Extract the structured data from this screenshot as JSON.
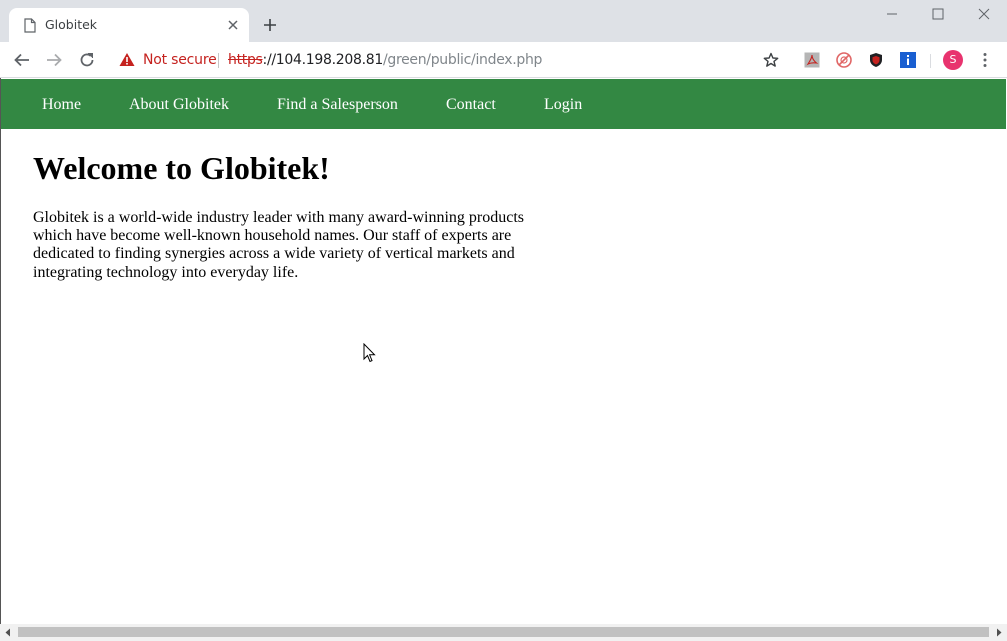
{
  "browser": {
    "tab": {
      "title": "Globitek"
    },
    "security": {
      "label": "Not secure"
    },
    "url": {
      "scheme": "https",
      "host": "://104.198.208.81",
      "path": "/green/public/index.php"
    },
    "profile": {
      "initial": "S"
    },
    "colors": {
      "warning": "#c5221f",
      "avatar": "#e8336e"
    }
  },
  "site": {
    "nav": {
      "items": [
        {
          "label": "Home"
        },
        {
          "label": "About Globitek"
        },
        {
          "label": "Find a Salesperson"
        },
        {
          "label": "Contact"
        },
        {
          "label": "Login"
        }
      ],
      "color": "#338843"
    },
    "heading": "Welcome to Globitek!",
    "intro": "Globitek is a world-wide industry leader with many award-winning products which have become well-known household names. Our staff of experts are dedicated to finding synergies across a wide variety of vertical markets and integrating technology into everyday life."
  }
}
